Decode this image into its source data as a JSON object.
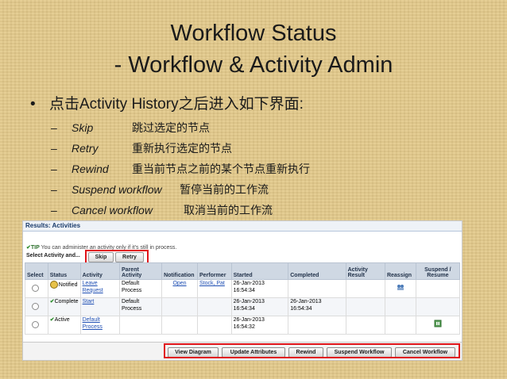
{
  "slide": {
    "title_line1": "Workflow Status",
    "title_line2": "- Workflow & Activity Admin",
    "bullet_symbol": "•",
    "bullet_text": "点击Activity History之后进入如下界面:",
    "sub_dash": "–",
    "items": [
      {
        "en": "Skip",
        "zh": "跳过选定的节点"
      },
      {
        "en": "Retry",
        "zh": "重新执行选定的节点"
      },
      {
        "en": "Rewind",
        "zh": "重当前节点之前的某个节点重新执行"
      },
      {
        "en": "Suspend workflow",
        "zh": "暂停当前的工作流"
      },
      {
        "en": "Cancel workflow",
        "zh": "取消当前的工作流"
      }
    ]
  },
  "screenshot": {
    "header": "Results: Activities",
    "tip_label": "TIP",
    "tip_text": "You can administer an activity only if it's still in process.",
    "select_label": "Select Activity and...",
    "skip_button": "Skip",
    "retry_button": "Retry",
    "columns": [
      "Select",
      "Status",
      "Activity",
      "Parent Activity",
      "Notification",
      "Performer",
      "Started",
      "Completed",
      "Activity Result",
      "Reassign",
      "Suspend / Resume"
    ],
    "rows": [
      {
        "status": "Notified",
        "activity": "Leave Request",
        "parent": "Default Process",
        "notification": "Open",
        "performer": "Stock, Pat",
        "started": "26-Jan-2013 16:54:34",
        "completed": "",
        "result": "",
        "reassign_icon": "reassign-icon",
        "suspend_icon": ""
      },
      {
        "status": "Complete",
        "activity": "Start",
        "parent": "Default Process",
        "notification": "",
        "performer": "",
        "started": "26-Jan-2013 16:54:34",
        "completed": "26-Jan-2013 16:54:34",
        "result": "",
        "reassign_icon": "",
        "suspend_icon": ""
      },
      {
        "status": "Active",
        "activity": "Default Process",
        "parent": "",
        "notification": "",
        "performer": "",
        "started": "26-Jan-2013 16:54:32",
        "completed": "",
        "result": "",
        "reassign_icon": "",
        "suspend_icon": "suspend-icon"
      }
    ],
    "bottom_buttons": [
      "View Diagram",
      "Update Attributes",
      "Rewind",
      "Suspend Workflow",
      "Cancel Workflow"
    ],
    "colors": {
      "highlight": "#e0141a",
      "link": "#1f4fb3",
      "header_bg": "#cfd8e3"
    }
  }
}
